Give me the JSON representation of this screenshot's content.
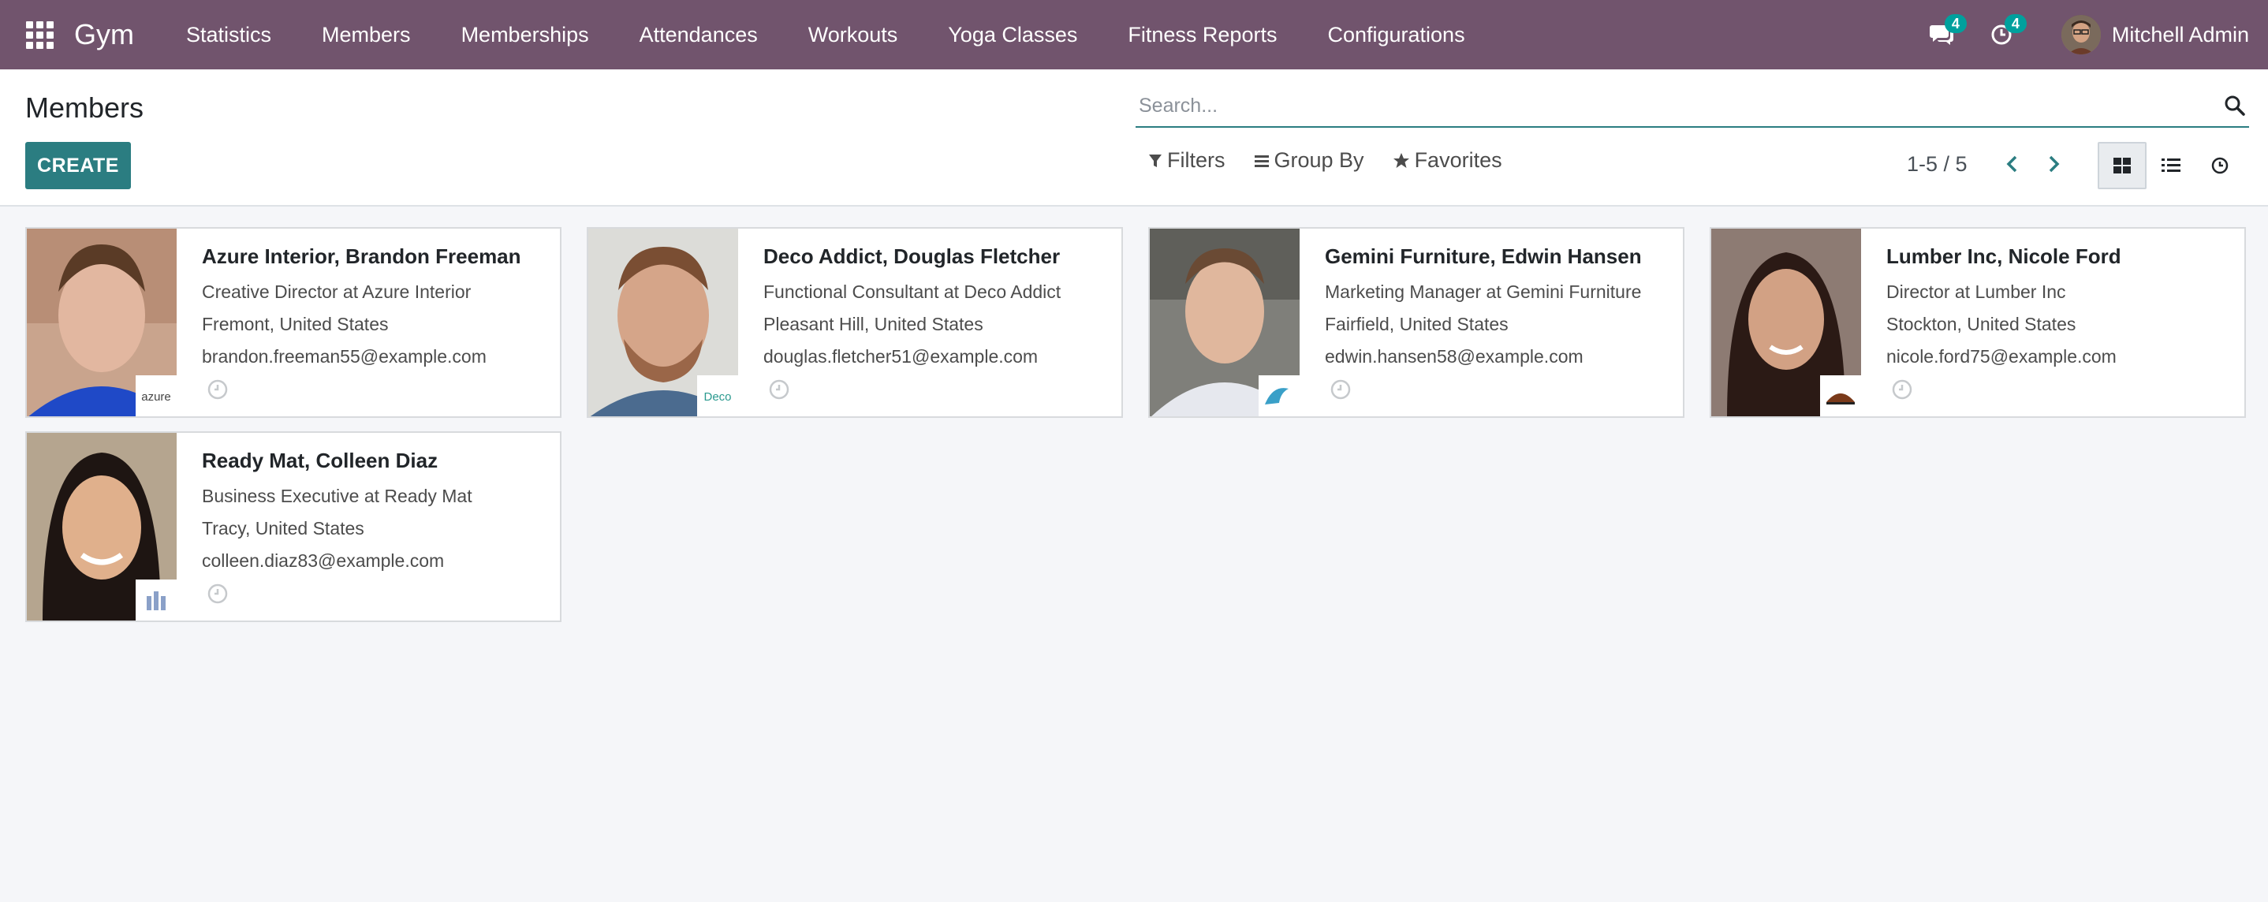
{
  "app": {
    "name": "Gym"
  },
  "nav": {
    "menu": [
      "Statistics",
      "Members",
      "Memberships",
      "Attendances",
      "Workouts",
      "Yoga Classes",
      "Fitness Reports",
      "Configurations"
    ],
    "messages_count": "4",
    "activities_count": "4",
    "user_name": "Mitchell Admin"
  },
  "control_panel": {
    "breadcrumb": "Members",
    "create_label": "CREATE",
    "search_placeholder": "Search...",
    "filters_label": "Filters",
    "group_by_label": "Group By",
    "favorites_label": "Favorites",
    "pager": "1-5 / 5"
  },
  "members": [
    {
      "name": "Azure Interior, Brandon Freeman",
      "job": "Creative Director at Azure Interior",
      "location": "Fremont, United States",
      "email": "brandon.freeman55@example.com",
      "logo_text": "azure",
      "photo_colors": [
        "#c89c83",
        "#1f49c7"
      ]
    },
    {
      "name": "Deco Addict, Douglas Fletcher",
      "job": "Functional Consultant at Deco Addict",
      "location": "Pleasant Hill, United States",
      "email": "douglas.fletcher51@example.com",
      "logo_text": "Deco",
      "photo_colors": [
        "#c79a80",
        "#d9d9d6"
      ]
    },
    {
      "name": "Gemini Furniture, Edwin Hansen",
      "job": "Marketing Manager at Gemini Furniture",
      "location": "Fairfield, United States",
      "email": "edwin.hansen58@example.com",
      "logo_text": "",
      "photo_colors": [
        "#d4ab93",
        "#e6e8ee"
      ]
    },
    {
      "name": "Lumber Inc, Nicole Ford",
      "job": "Director at Lumber Inc",
      "location": "Stockton, United States",
      "email": "nicole.ford75@example.com",
      "logo_text": "",
      "photo_colors": [
        "#c08a72",
        "#2b1a15"
      ]
    },
    {
      "name": "Ready Mat, Colleen Diaz",
      "job": "Business Executive at Ready Mat",
      "location": "Tracy, United States",
      "email": "colleen.diaz83@example.com",
      "logo_text": "",
      "photo_colors": [
        "#d9a985",
        "#1e1512"
      ]
    }
  ]
}
